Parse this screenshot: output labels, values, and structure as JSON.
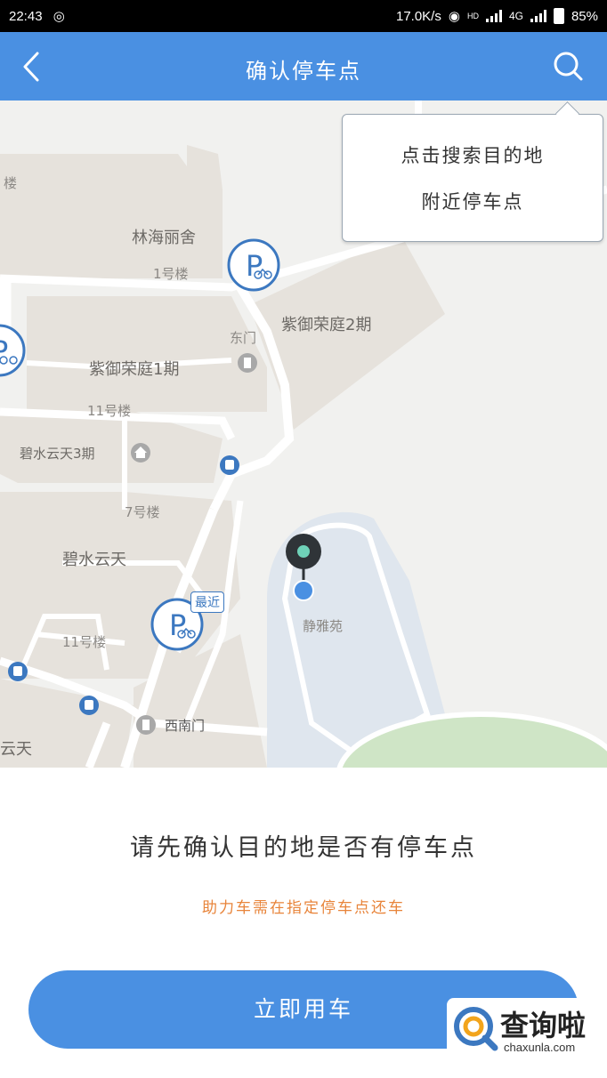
{
  "status_bar": {
    "time": "22:43",
    "speed": "17.0K/s",
    "hd": "HD",
    "network": "4G",
    "battery": "85%"
  },
  "header": {
    "title": "确认停车点",
    "back_icon": "chevron-left-icon",
    "search_icon": "search-icon"
  },
  "map": {
    "labels": {
      "lou": "楼",
      "linhai": "林海丽舍",
      "bldg1": "1号楼",
      "ziyu2": "紫御荣庭2期",
      "dongmen": "东门",
      "ziyu1": "紫御荣庭1期",
      "bldg11a": "11号楼",
      "bishui3": "碧水云天3期",
      "bldg7": "7号楼",
      "bishui": "碧水云天",
      "bldg11b": "11号楼",
      "jingya": "静雅苑",
      "xinanmen": "西南门",
      "yuntian": "云天"
    },
    "nearest_badge": "最近"
  },
  "tooltip": {
    "line1": "点击搜索目的地",
    "line2": "附近停车点"
  },
  "prompt": {
    "question": "请先确认目的地是否有停车点",
    "note": "助力车需在指定停车点还车"
  },
  "action": {
    "use_now": "立即用车"
  },
  "watermark": {
    "cn": "查询啦",
    "en": "chaxunla.com"
  },
  "colors": {
    "brand_blue": "#4a90e2",
    "note_orange": "#e8843a"
  }
}
